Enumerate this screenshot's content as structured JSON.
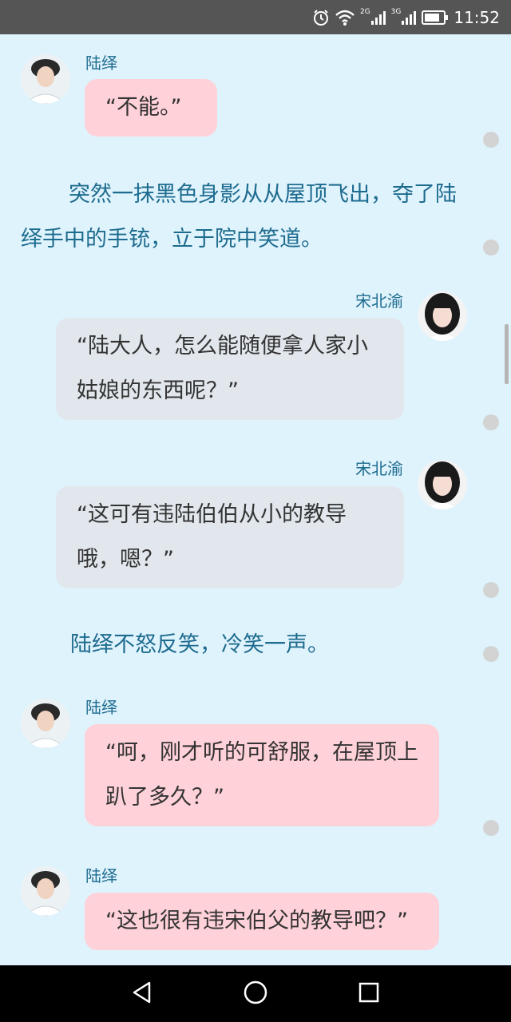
{
  "status_bar": {
    "time": "11:52",
    "network_2g": "2G",
    "network_3g": "3G",
    "icons": [
      "alarm-icon",
      "wifi-icon",
      "signal-2g-icon",
      "signal-3g-icon",
      "battery-icon"
    ]
  },
  "chat": {
    "messages": [
      {
        "type": "dialog",
        "speaker": "陆绎",
        "side": "left",
        "text": "“不能。”"
      },
      {
        "type": "narration",
        "text": "突然一抹黑色身影从从屋顶飞出，夺了陆绎手中的手铳，立于院中笑道。"
      },
      {
        "type": "dialog",
        "speaker": "宋北渝",
        "side": "right",
        "text": "“陆大人，怎么能随便拿人家小姑娘的东西呢？”"
      },
      {
        "type": "dialog",
        "speaker": "宋北渝",
        "side": "right",
        "text": "“这可有违陆伯伯从小的教导哦，嗯？”"
      },
      {
        "type": "narration",
        "text": "陆绎不怒反笑，冷笑一声。"
      },
      {
        "type": "dialog",
        "speaker": "陆绎",
        "side": "left",
        "text": "“呵，刚才听的可舒服，在屋顶上趴了多久？”"
      },
      {
        "type": "dialog",
        "speaker": "陆绎",
        "side": "left",
        "text": "“这也很有违宋伯父的教导吧？”"
      }
    ]
  },
  "colors": {
    "background": "#dff3fd",
    "pink_bubble": "#ffd1d9",
    "gray_bubble": "#e1e7ec",
    "name_text": "#1d6b8e",
    "status_bar": "#555555",
    "nav_bar": "#000000"
  },
  "nav_bar": {
    "icons": [
      "back-icon",
      "home-icon",
      "recents-icon"
    ]
  }
}
